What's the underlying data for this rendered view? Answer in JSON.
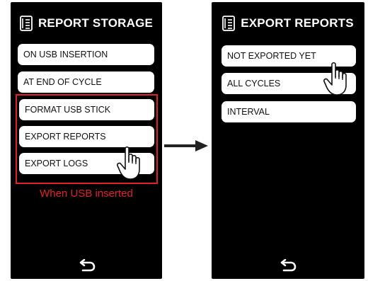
{
  "left_screen": {
    "title": "REPORT STORAGE",
    "items": [
      {
        "label": "ON USB INSERTION"
      },
      {
        "label": "AT END OF CYCLE"
      },
      {
        "label": "FORMAT USB STICK"
      },
      {
        "label": "EXPORT REPORTS"
      },
      {
        "label": "EXPORT LOGS"
      }
    ],
    "caption": "When USB inserted"
  },
  "right_screen": {
    "title": "EXPORT REPORTS",
    "items": [
      {
        "label": "NOT EXPORTED YET"
      },
      {
        "label": "ALL CYCLES"
      },
      {
        "label": "INTERVAL"
      }
    ]
  },
  "colors": {
    "screen_bg": "#000000",
    "button_bg": "#ffffff",
    "highlight": "#e0202a"
  },
  "icons": [
    "report-icon",
    "back-arrow-icon",
    "pointer-hand-icon",
    "right-arrow-icon"
  ]
}
